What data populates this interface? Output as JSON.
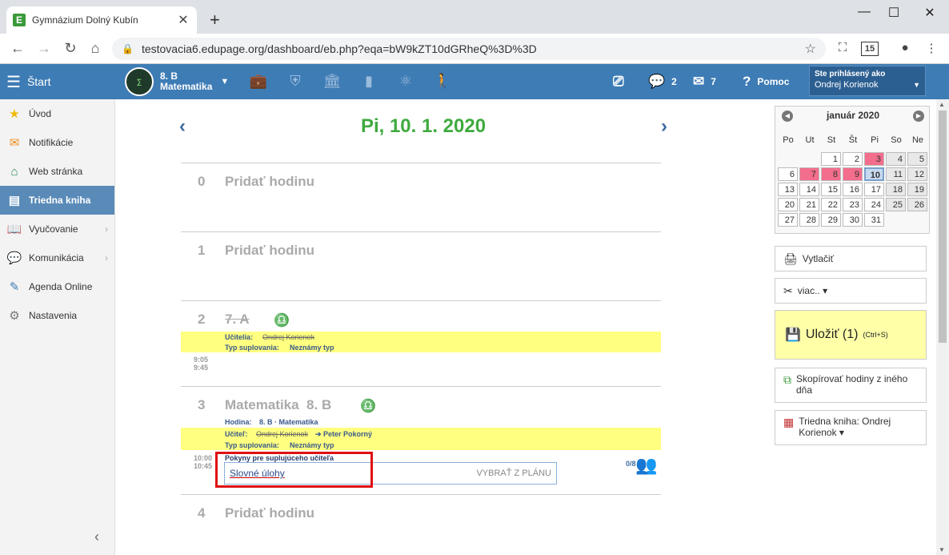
{
  "browser": {
    "tab_title": "Gymnázium Dolný Kubín",
    "tab_favicon": "E",
    "url": "testovacia6.edupage.org/dashboard/eb.php?eqa=bW9kZT10dGRheQ%3D%3D",
    "ext_badge": "15"
  },
  "appbar": {
    "start_label": "Štart",
    "class_name": "8. B",
    "subject_name": "Matematika",
    "messages_count": "2",
    "mail_count": "7",
    "help_label": "Pomoc",
    "signed_in_label": "Ste prihlásený ako",
    "user_name": "Ondrej Korienok"
  },
  "sidebar": {
    "items": [
      {
        "label": "Úvod",
        "icon": "star-icon"
      },
      {
        "label": "Notifikácie",
        "icon": "envelope-icon"
      },
      {
        "label": "Web stránka",
        "icon": "home-icon"
      },
      {
        "label": "Triedna kniha",
        "icon": "book-icon"
      },
      {
        "label": "Vyučovanie",
        "icon": "open-book-icon"
      },
      {
        "label": "Komunikácia",
        "icon": "chat-icon"
      },
      {
        "label": "Agenda Online",
        "icon": "pen-icon"
      },
      {
        "label": "Nastavenia",
        "icon": "gear-icon"
      }
    ]
  },
  "main": {
    "date": "Pi, 10. 1. 2020",
    "p0_num": "0",
    "p0_title": "Pridať hodinu",
    "p1_num": "1",
    "p1_title": "Pridať hodinu",
    "p2_num": "2",
    "p2_title": "7. A",
    "p2_teachers_label": "Učitelia:",
    "p2_teacher": "Ondrej Korienok",
    "p2_subst_label": "Typ suplovania:",
    "p2_subst_value": "Neznámy typ",
    "p2_time_start": "9:05",
    "p2_time_end": "9:45",
    "p3_num": "3",
    "p3_title": "Matematika  8. B",
    "p3_lesson_label": "Hodina:",
    "p3_lesson_value": "8. B · Matematika",
    "p3_teacher_label": "Učiteľ:",
    "p3_teacher_old": "Ondrej Korienok",
    "p3_teacher_new": "➔ Peter Pokorný",
    "p3_subst_label": "Typ suplovania:",
    "p3_subst_value": "Neznámy typ",
    "p3_time_start": "10:00",
    "p3_time_end": "10:45",
    "instructions_label": "Pokyny pre suplujúceho učiteľa",
    "instructions_value": "Slovné úlohy",
    "pick_from_plan": "VYBRAŤ Z PLÁNU",
    "attendance": "0/8",
    "p4_num": "4",
    "p4_title": "Pridať hodinu"
  },
  "calendar": {
    "month": "január 2020",
    "dow": [
      "Po",
      "Ut",
      "St",
      "Št",
      "Pi",
      "So",
      "Ne"
    ],
    "weeks": [
      [
        "",
        "",
        "1",
        "2",
        "3",
        "4",
        "5"
      ],
      [
        "6",
        "7",
        "8",
        "9",
        "10",
        "11",
        "12"
      ],
      [
        "13",
        "14",
        "15",
        "16",
        "17",
        "18",
        "19"
      ],
      [
        "20",
        "21",
        "22",
        "23",
        "24",
        "25",
        "26"
      ],
      [
        "27",
        "28",
        "29",
        "30",
        "31",
        "",
        ""
      ]
    ],
    "highlighted_days": [
      "3",
      "7",
      "8",
      "9"
    ],
    "selected_day": "10",
    "highlight_color": "#f36d8c"
  },
  "actions": {
    "print": "Vytlačiť",
    "more": "viac.. ▾",
    "save": "Uložiť (1)",
    "save_shortcut": "(Ctrl+S)",
    "copy": "Skopírovať hodiny z iného dňa",
    "classbook": "Triedna kniha: Ondrej Korienok ▾"
  }
}
